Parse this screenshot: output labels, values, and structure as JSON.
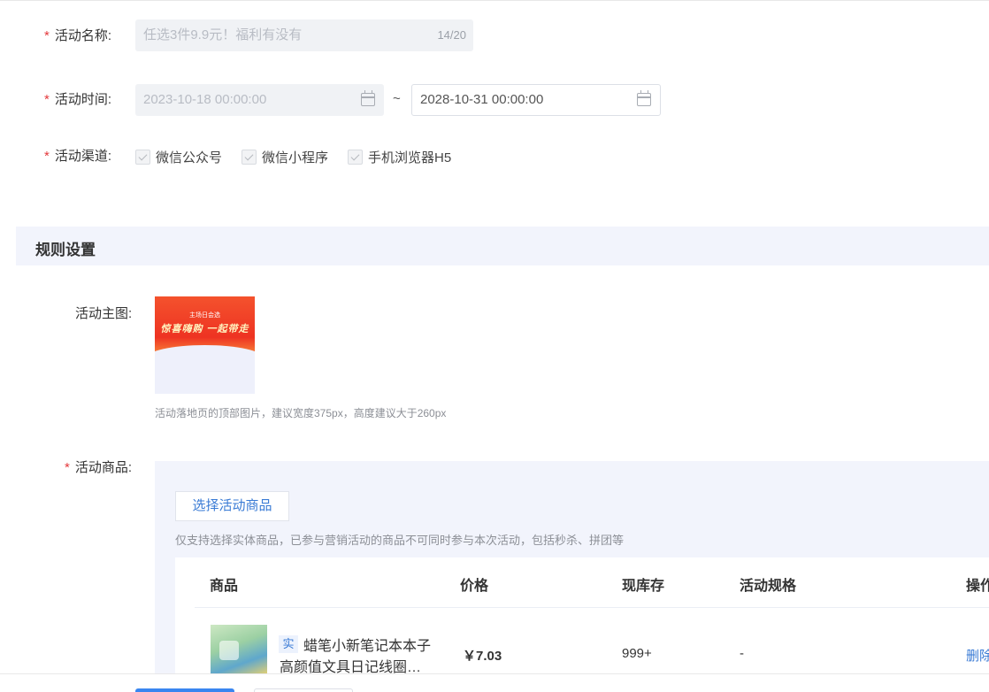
{
  "form": {
    "name_label": "活动名称:",
    "name_value": "任选3件9.9元！福利有没有",
    "name_counter": "14/20",
    "time_label": "活动时间:",
    "start_time": "2023-10-18 00:00:00",
    "time_separator": "~",
    "end_time": "2028-10-31 00:00:00",
    "channel_label": "活动渠道:",
    "channels": [
      "微信公众号",
      "微信小程序",
      "手机浏览器H5"
    ],
    "required_mark": "*"
  },
  "rules": {
    "section_title": "规则设置",
    "banner_label": "活动主图:",
    "banner_small_text": "主场日会选",
    "banner_big_text": "惊喜嗨购 一起带走",
    "banner_hint": "活动落地页的顶部图片，建议宽度375px，高度建议大于260px",
    "goods_label": "活动商品:",
    "select_button": "选择活动商品",
    "goods_hint": "仅支持选择实体商品，已参与营销活动的商品不可同时参与本次活动，包括秒杀、拼团等"
  },
  "table": {
    "headers": [
      "商品",
      "价格",
      "现库存",
      "活动规格",
      "操作"
    ],
    "rows": [
      {
        "tag": "实",
        "name_line1": "蜡笔小新笔记本本子",
        "name_line2": "高颜值文具日记线圈…",
        "price": "￥7.03",
        "stock": "999+",
        "spec": "-",
        "action": "删除"
      }
    ]
  },
  "colors": {
    "primary": "#3a7bd5",
    "required": "#e4393c",
    "section_bg": "#f2f4fc"
  }
}
